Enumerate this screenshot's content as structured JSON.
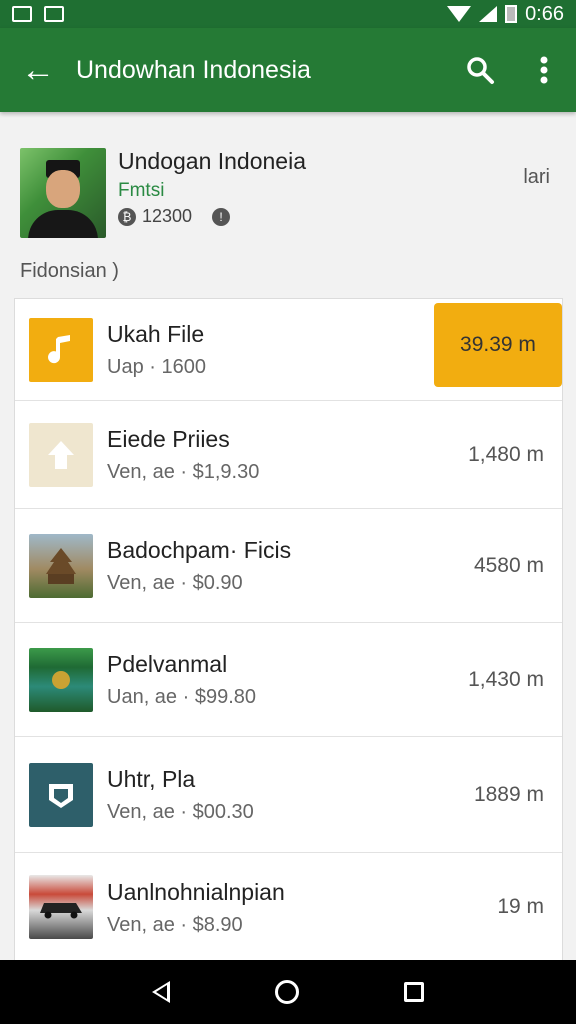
{
  "status_bar": {
    "time": "0:66"
  },
  "app_bar": {
    "title": "Undowhan Indonesia",
    "back_icon": "arrow-left-icon",
    "search_icon": "search-icon",
    "more_icon": "more-vert-icon",
    "color": "#257a35"
  },
  "profile": {
    "name": "Undogan Indoneia",
    "subtitle": "Fmtsi",
    "count": "12300",
    "side_label": "lari"
  },
  "section": {
    "label": "Fidonsian )"
  },
  "items": [
    {
      "title": "Ukah File",
      "subtitle": "Uap · 1600",
      "value": "39.39 m",
      "icon": "music-note-icon",
      "thumb_color": "#f2ad10",
      "highlight": true
    },
    {
      "title": "Eiede Priies",
      "subtitle": "Ven, ae · $1,9.30",
      "value": "1,480 m",
      "icon": "upload-icon",
      "thumb_color": "#efe6cf"
    },
    {
      "title": "Badochpam· Ficis",
      "subtitle": "Ven, ae · $0.90",
      "value": "4580 m",
      "icon": "temple-image",
      "thumb_color": "#6b5a3a"
    },
    {
      "title": "Pdelvanmal",
      "subtitle": "Uan, ae · $99.80",
      "value": "1,430 m",
      "icon": "landscape-image",
      "thumb_color": "#2f7a3a"
    },
    {
      "title": "Uhtr, Pla",
      "subtitle": "Ven, ae · $00.30",
      "value": "1889 m",
      "icon": "chat-badge-icon",
      "thumb_color": "#2e5f6a"
    },
    {
      "title": "Uanlnohnialnpian",
      "subtitle": "Ven, ae · $8.90",
      "value": "19 m",
      "icon": "car-image",
      "thumb_color": "#5a5a5a"
    }
  ]
}
